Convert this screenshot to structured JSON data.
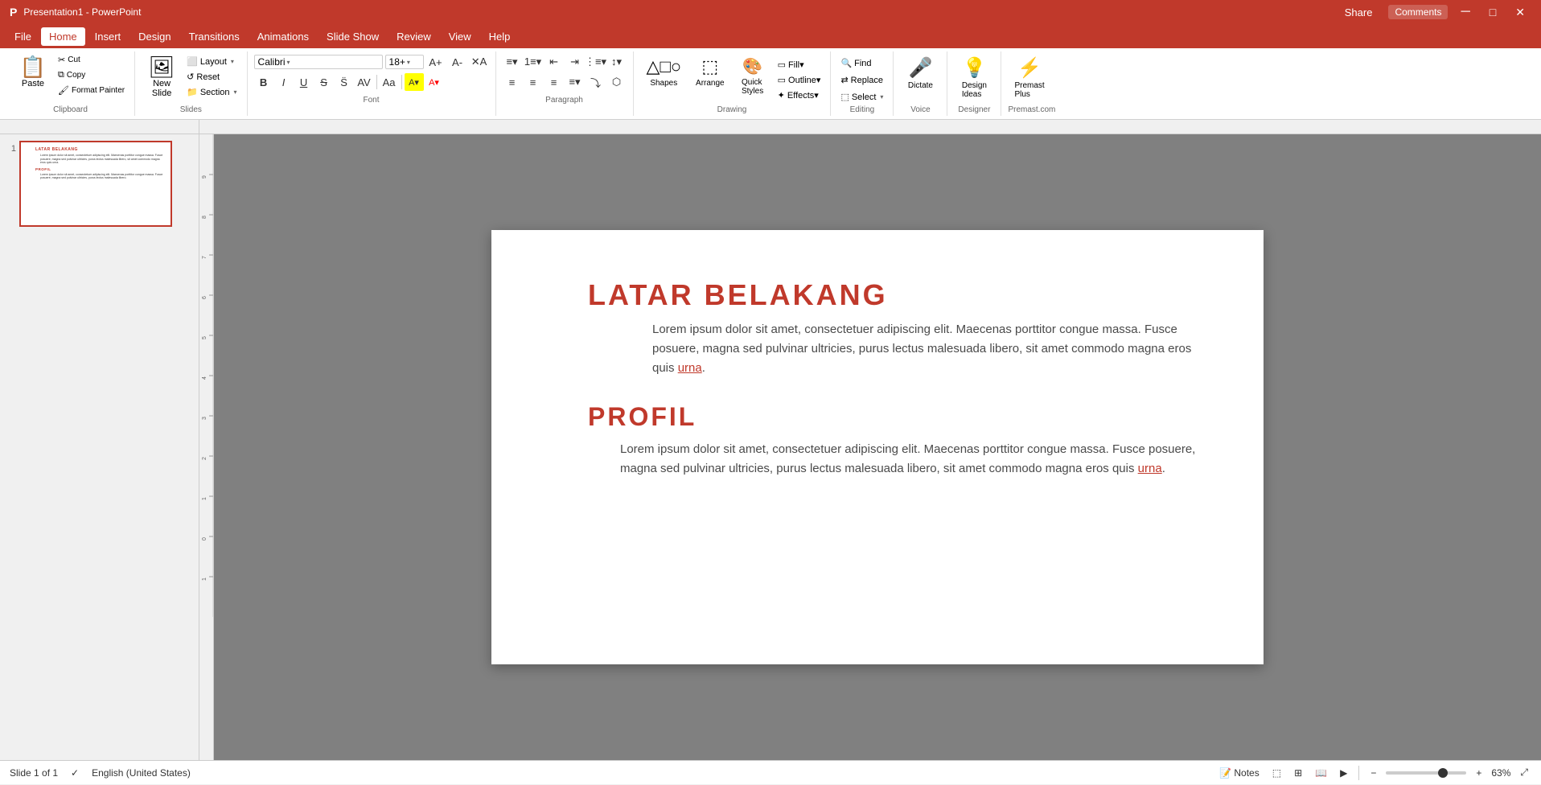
{
  "app": {
    "title": "Presentation1 - PowerPoint",
    "accent_color": "#c0392b",
    "accent_color_light": "#e74c3c"
  },
  "menu_bar": {
    "items": [
      "File",
      "Home",
      "Insert",
      "Design",
      "Transitions",
      "Animations",
      "Slide Show",
      "Review",
      "View",
      "Help"
    ],
    "active": "Home"
  },
  "ribbon": {
    "clipboard_group": "Clipboard",
    "slides_group": "Slides",
    "font_group": "Font",
    "paragraph_group": "Paragraph",
    "drawing_group": "Drawing",
    "editing_group": "Editing",
    "voice_group": "Voice",
    "designer_group": "Designer",
    "premastplus_group": "Premast.com",
    "paste_label": "Paste",
    "new_slide_label": "New\nSlide",
    "layout_label": "Layout",
    "reset_label": "Reset",
    "section_label": "Section",
    "shapes_label": "Shapes",
    "arrange_label": "Arrange",
    "quick_styles_label": "Quick\nStyles",
    "find_label": "Find",
    "replace_label": "Replace",
    "select_label": "Select",
    "dictate_label": "Dictate",
    "design_ideas_label": "Design\nIdeas",
    "premast_plus_label": "Premast\nPlus",
    "font_name": "Calibri",
    "font_size": "18+",
    "bold": "B",
    "italic": "I",
    "underline": "U",
    "strikethrough": "S"
  },
  "slide": {
    "heading1": "LATAR BELAKANG",
    "body1": "Lorem ipsum dolor sit amet, consectetuer adipiscing elit. Maecenas porttitor congue massa. Fusce posuere, magna sed pulvinar ultricies, purus lectus malesuada libero, sit amet commodo magna eros quis urna.",
    "body1_link": "urna",
    "heading2": "PROFIL",
    "body2": "Lorem ipsum dolor sit amet, consectetuer adipiscing elit. Maecenas porttitor congue massa. Fusce posuere, magna sed pulvinar ultricies, purus lectus malesuada libero, sit amet commodo magna eros quis urna.",
    "body2_link": "urna"
  },
  "status_bar": {
    "slide_info": "Slide 1 of 1",
    "language": "English (United States)",
    "accessibility": "✓",
    "notes_label": "Notes",
    "zoom_level": "63%",
    "zoom_value": 63
  },
  "header_buttons": {
    "share_label": "Share",
    "comments_label": "Comments",
    "minimize": "─",
    "maximize": "□",
    "close": "✕"
  }
}
